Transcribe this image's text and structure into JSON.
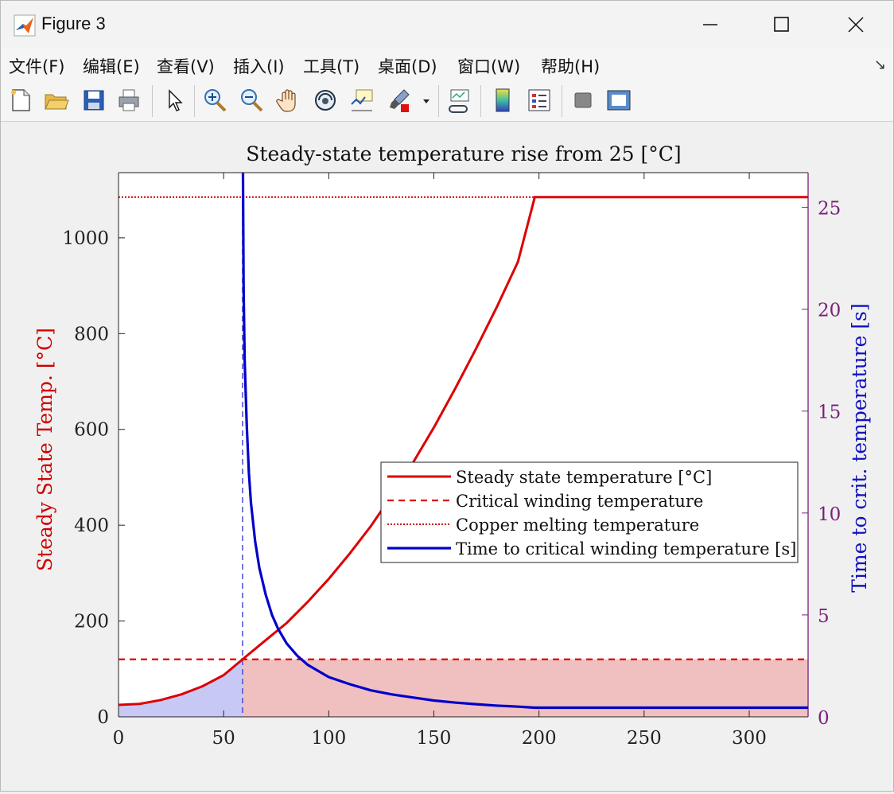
{
  "window": {
    "title": "Figure 3"
  },
  "menu": [
    "文件(F)",
    "编辑(E)",
    "查看(V)",
    "插入(I)",
    "工具(T)",
    "桌面(D)",
    "窗口(W)",
    "帮助(H)"
  ],
  "toolbar_icons": [
    "new-file-icon",
    "open-folder-icon",
    "save-icon",
    "print-icon",
    "pointer-icon",
    "zoom-in-icon",
    "zoom-out-icon",
    "pan-hand-icon",
    "rotate-3d-icon",
    "data-cursor-icon",
    "brush-icon",
    "brush-dropdown-icon",
    "link-plot-icon",
    "colorbar-icon",
    "legend-icon",
    "hide-plot-tools-icon",
    "show-plot-tools-icon"
  ],
  "chart_data": {
    "type": "line",
    "title": "Steady-state temperature rise from 25 [°C]",
    "xlabel": "",
    "ylabel_left": "Steady State Temp. [°C]",
    "ylabel_right": "Time to crit. temperature [s]",
    "xlim": [
      0,
      328
    ],
    "ylim_left": [
      0,
      1136
    ],
    "ylim_right": [
      0,
      26.7
    ],
    "xticks": [
      0,
      50,
      100,
      150,
      200,
      250,
      300
    ],
    "yticks_left": [
      0,
      200,
      400,
      600,
      800,
      1000
    ],
    "yticks_right": [
      0,
      5,
      10,
      15,
      20,
      25
    ],
    "critical_temperature": 120,
    "copper_melting_temperature": 1085,
    "critical_x": 59,
    "legend_position": "center-right",
    "colors": {
      "steady": "#dd0000",
      "critical": "#dd0000",
      "copper": "#cc0000",
      "time": "#0000cc",
      "fill_left": "#c8c8f5",
      "fill_right": "#f0c0c0",
      "right_axis": "#7a1f7a"
    },
    "series": [
      {
        "name": "Steady state temperature [°C]",
        "style": "solid",
        "x": [
          0,
          10,
          20,
          30,
          40,
          50,
          59,
          70,
          80,
          90,
          100,
          110,
          120,
          130,
          140,
          150,
          160,
          170,
          180,
          190,
          198,
          210,
          230,
          260,
          290,
          328
        ],
        "y": [
          25,
          27,
          35,
          47,
          64,
          87,
          120,
          160,
          196,
          240,
          288,
          341,
          398,
          462,
          530,
          604,
          684,
          768,
          856,
          950,
          1085,
          1085,
          1085,
          1085,
          1085,
          1085
        ]
      },
      {
        "name": "Critical winding temperature",
        "style": "dashed",
        "x": [
          0,
          328
        ],
        "y": [
          120,
          120
        ]
      },
      {
        "name": "Copper melting temperature",
        "style": "dotted",
        "x": [
          0,
          198
        ],
        "y": [
          1085,
          1085
        ]
      },
      {
        "name": "Time to critical winding temperature [s]",
        "style": "solid",
        "axis": "right",
        "x": [
          59.2,
          59.5,
          60,
          61,
          62,
          63,
          65,
          67,
          70,
          73,
          76,
          80,
          85,
          90,
          100,
          110,
          120,
          130,
          140,
          150,
          160,
          170,
          180,
          190,
          198,
          230,
          260,
          290,
          328
        ],
        "y": [
          26.7,
          21.0,
          17.5,
          14.3,
          12.0,
          10.5,
          8.6,
          7.3,
          6.0,
          5.0,
          4.3,
          3.6,
          3.0,
          2.55,
          1.95,
          1.6,
          1.3,
          1.1,
          0.95,
          0.8,
          0.7,
          0.62,
          0.55,
          0.5,
          0.45,
          0.45,
          0.45,
          0.45,
          0.45
        ]
      }
    ]
  }
}
